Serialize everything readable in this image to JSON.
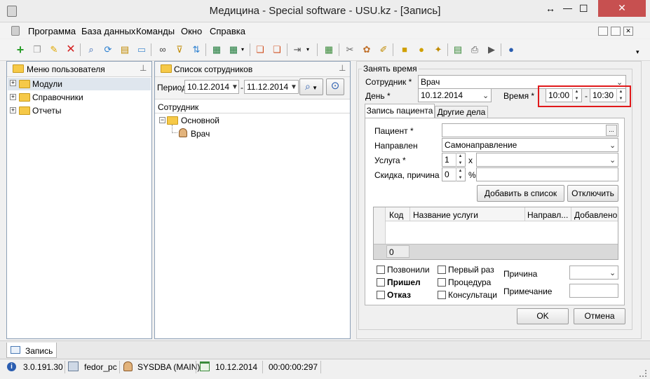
{
  "window": {
    "title": "Медицина - Special software - USU.kz - [Запись]",
    "move_glyph": "↔",
    "min_glyph": "—",
    "max_glyph": "☐",
    "close_glyph": "✕"
  },
  "menu": {
    "items": [
      "Программа",
      "База данных",
      "Команды",
      "Окно",
      "Справка"
    ]
  },
  "toolbar": {
    "icons": [
      "add-icon",
      "copy-icon",
      "edit-icon",
      "delete-icon",
      "search-icon",
      "refresh-icon",
      "import-icon",
      "comment-icon",
      "binoculars-icon",
      "filter-icon",
      "sort-icon",
      "export-excel-icon",
      "export-icon",
      "new-window-icon",
      "new-item-icon",
      "exit-icon",
      "calendar-icon",
      "tools-icon",
      "palette-icon",
      "note-icon",
      "lock-icon",
      "users-icon",
      "wizard-icon",
      "table-icon",
      "print-icon",
      "play-icon",
      "help-icon"
    ]
  },
  "user_menu": {
    "title": "Меню пользователя",
    "items": [
      "Модули",
      "Справочники",
      "Отчеты"
    ]
  },
  "employees": {
    "title": "Список сотрудников",
    "period_label": "Период",
    "date_from": "10.12.2014",
    "date_to": "11.12.2014",
    "dash": "-",
    "column": "Сотрудник",
    "group": "Основной",
    "employee": "Врач"
  },
  "form": {
    "group_title": "Занять время",
    "employee_label": "Сотрудник *",
    "employee_value": "Врач",
    "day_label": "День *",
    "day_value": "10.12.2014",
    "time_label": "Время *",
    "time_from": "10:00",
    "time_to": "10:30",
    "time_dash": "-",
    "tabs": [
      "Запись пациента",
      "Другие дела"
    ],
    "patient_label": "Пациент *",
    "patient_value": "",
    "ellipsis": "...",
    "direction_label": "Направлен",
    "direction_value": "Самонаправление",
    "service_label": "Услуга *",
    "service_qty": "1",
    "times_sign": "x",
    "service_value": "",
    "discount_label": "Скидка, причина",
    "discount_value": "0",
    "percent_sign": "%",
    "discount_reason": "",
    "add_button": "Добавить в список",
    "disable_button": "Отключить",
    "grid_columns": [
      "Код",
      "Название услуги",
      "Направл...",
      "Добавлено"
    ],
    "grid_total": "0",
    "checkboxes": {
      "called": "Позвонили",
      "came": "Пришел",
      "refused": "Отказ",
      "first_time": "Первый раз",
      "procedure": "Процедура",
      "consultation": "Консультаци"
    },
    "reason_label": "Причина",
    "reason_value": "",
    "note_label": "Примечание",
    "note_value": "",
    "ok_button": "OK",
    "cancel_button": "Отмена"
  },
  "bottom_tab": "Запись",
  "status": {
    "version": "3.0.191.30",
    "pc": "fedor_pc",
    "user": "SYSDBA (MAIN)",
    "date": "10.12.2014",
    "timer": "00:00:00:297"
  },
  "colors": {
    "highlight": "#e0191b",
    "folder": "#f6c948"
  }
}
